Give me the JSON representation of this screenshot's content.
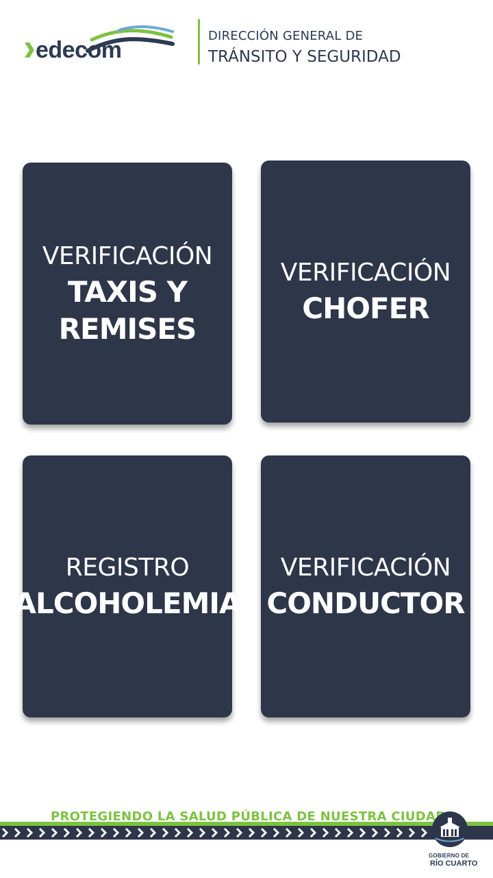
{
  "header": {
    "brand": "edecom",
    "department_line1": "DIRECCIÓN GENERAL DE",
    "department_line2": "TRÁNSITO Y SEGURIDAD"
  },
  "tiles": [
    {
      "line1": "VERIFICACIÓN",
      "line2": "TAXIS Y",
      "line3": "REMISES"
    },
    {
      "line1": "VERIFICACIÓN",
      "line2": "CHOFER"
    },
    {
      "line1": "REGISTRO",
      "line2": "ALCOHOLEMIA"
    },
    {
      "line1": "VERIFICACIÓN",
      "line2": "CONDUCTOR"
    }
  ],
  "footer": {
    "slogan": "PROTEGIENDO LA SALUD PÚBLICA DE NUESTRA CIUDAD",
    "gov_line1": "GOBIERNO DE",
    "gov_line2": "RÍO CUARTO"
  },
  "colors": {
    "tile_bg": "#2e3649",
    "accent_green": "#7cc242",
    "text_dark": "#2c3a52",
    "wave_blue": "#6aa9d8"
  },
  "icons": [
    "chevron-right-icon",
    "wave-logo-icon",
    "municipal-building-icon"
  ]
}
